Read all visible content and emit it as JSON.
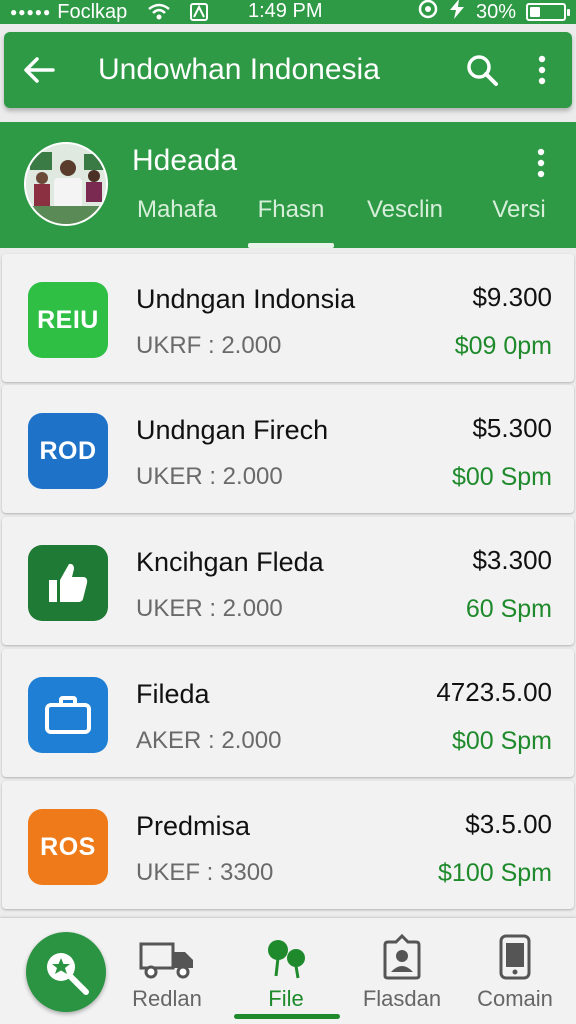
{
  "status_bar": {
    "carrier": "Foclkap",
    "time": "1:49 PM",
    "battery_text": "30%",
    "battery_level": 0.3
  },
  "app_bar": {
    "title": "Undowhan Indonesia",
    "back_icon": "arrow-left-icon",
    "search_icon": "search-icon",
    "menu_icon": "more-vertical-icon"
  },
  "profile": {
    "name": "Hdeada",
    "tabs": [
      "Mahafa",
      "Fhasn",
      "Vesclin",
      "Versi"
    ],
    "active_tab": 1
  },
  "items": [
    {
      "badge": "REIU",
      "badge_color": "#2fbf45",
      "name": "Undngan Indonsia",
      "sub": "UKRF : 2.000",
      "price": "$9.300",
      "time": "$09 0pm"
    },
    {
      "badge": "ROD",
      "badge_color": "#1e73c8",
      "name": "Undngan Firech",
      "sub": "UKER : 2.000",
      "price": "$5.300",
      "time": "$00 Spm"
    },
    {
      "badge": "",
      "badge_icon": "thumbs-up-icon",
      "badge_color": "#1e7a34",
      "name": "Kncihgan Fleda",
      "sub": "UKER : 2.000",
      "price": "$3.300",
      "time": "60 Spm"
    },
    {
      "badge": "",
      "badge_icon": "briefcase-icon",
      "badge_color": "#1e7fd4",
      "name": "Fileda",
      "sub": "AKER : 2.000",
      "price": "4723.5.00",
      "time": "$00 Spm"
    },
    {
      "badge": "ROS",
      "badge_color": "#ef7a1a",
      "name": "Predmisa",
      "sub": "UKEF : 3300",
      "price": "$3.5.00",
      "time": "$100 Spm"
    }
  ],
  "bottom_nav": {
    "fab_icon": "magnifier-star-icon",
    "items": [
      {
        "label": "Redlan",
        "icon": "truck-icon"
      },
      {
        "label": "File",
        "icon": "pins-icon"
      },
      {
        "label": "Flasdan",
        "icon": "id-badge-icon"
      },
      {
        "label": "Comain",
        "icon": "phone-icon"
      }
    ],
    "active": 1
  },
  "colors": {
    "primary": "#2e9a45",
    "accent_text": "#1f8a2c",
    "background": "#ececec"
  }
}
